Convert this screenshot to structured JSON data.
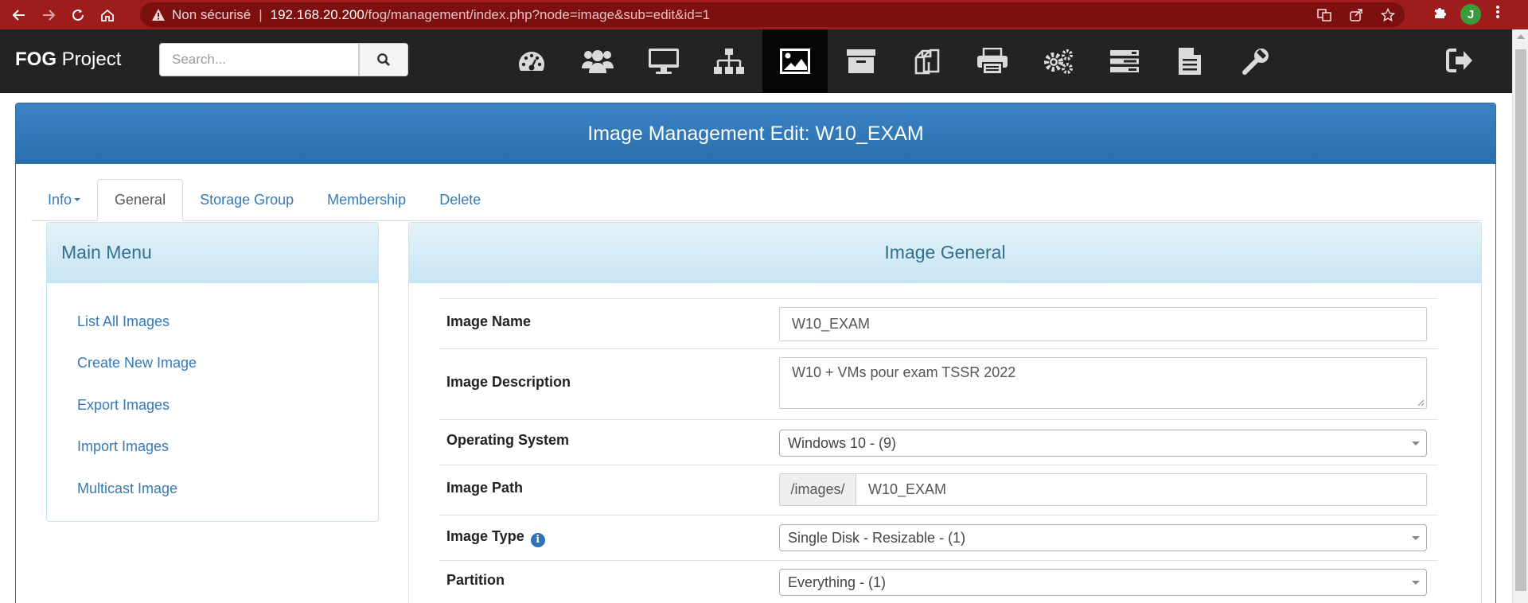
{
  "browser": {
    "insecure_label": "Non sécurisé",
    "url_host": "192.168.20.200",
    "url_path": "/fog/management/index.php?node=image&sub=edit&id=1",
    "avatar_letter": "J"
  },
  "navbar": {
    "brand_bold": "FOG",
    "brand_rest": " Project",
    "search_placeholder": "Search...",
    "icons": [
      "dashboard-icon",
      "users-icon",
      "hosts-icon",
      "groups-icon",
      "images-icon",
      "storage-icon",
      "snapins-icon",
      "printers-icon",
      "services-icon",
      "tasks-icon",
      "reports-icon",
      "settings-icon"
    ],
    "active_icon": "images-icon"
  },
  "panel": {
    "title": "Image Management Edit: W10_EXAM"
  },
  "tabs": [
    {
      "label": "Info"
    },
    {
      "label": "General"
    },
    {
      "label": "Storage Group"
    },
    {
      "label": "Membership"
    },
    {
      "label": "Delete"
    }
  ],
  "main_menu": {
    "title": "Main Menu",
    "items": [
      "List All Images",
      "Create New Image",
      "Export Images",
      "Import Images",
      "Multicast Image"
    ]
  },
  "image_general": {
    "title": "Image General",
    "fields": {
      "name_label": "Image Name",
      "name_value": "W10_EXAM",
      "description_label": "Image Description",
      "description_value": "W10 + VMs pour exam TSSR 2022",
      "os_label": "Operating System",
      "os_value": "Windows 10 - (9)",
      "path_label": "Image Path",
      "path_prefix": "/images/",
      "path_value": "W10_EXAM",
      "type_label": "Image Type",
      "type_value": "Single Disk - Resizable - (1)",
      "partition_label": "Partition",
      "partition_value": "Everything - (1)"
    }
  }
}
